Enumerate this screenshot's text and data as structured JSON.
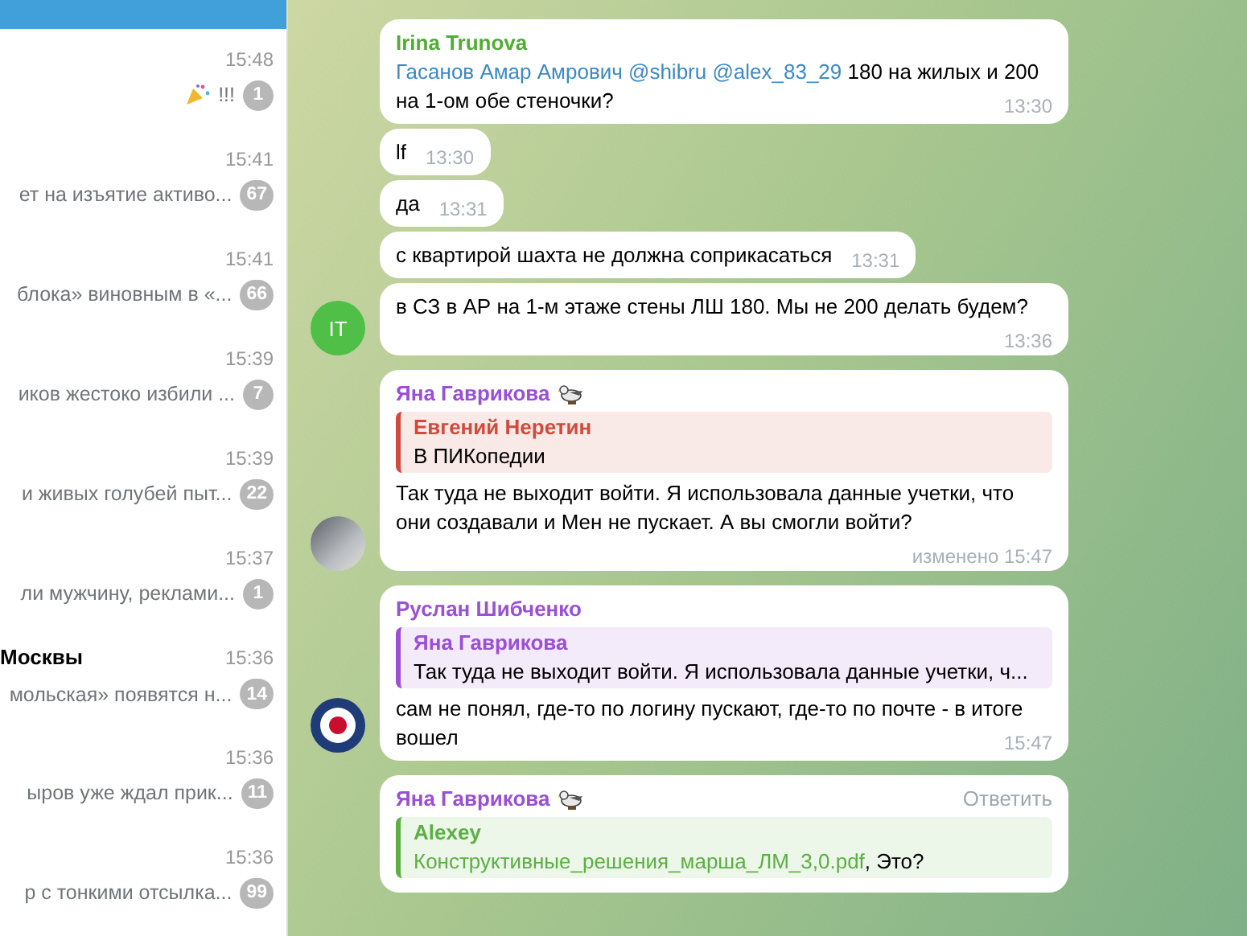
{
  "chat_list": [
    {
      "time": "15:48",
      "preview": "!!!",
      "preview_emoji": true,
      "badge": "1"
    },
    {
      "time": "15:41",
      "preview": "ет на изъятие активо...",
      "badge": "67"
    },
    {
      "time": "15:41",
      "preview": "блока» виновным в «...",
      "badge": "66"
    },
    {
      "time": "15:39",
      "preview": "иков жестоко избили ...",
      "badge": "7"
    },
    {
      "time": "15:39",
      "preview": "и живых голубей пыт...",
      "badge": "22"
    },
    {
      "time": "15:37",
      "preview": "ли мужчину, реклами...",
      "badge": "1"
    },
    {
      "title": "Москвы",
      "time": "15:36",
      "preview": "мольская» появятся н...",
      "badge": "14"
    },
    {
      "time": "15:36",
      "preview": "ыров  уже ждал прик...",
      "badge": "11"
    },
    {
      "time": "15:36",
      "preview": "р с тонкими отсылка...",
      "badge": "99"
    }
  ],
  "groups": [
    {
      "avatar": {
        "kind": "initials",
        "initials": "IT",
        "color": "#4fbf48"
      },
      "messages": [
        {
          "sender": "Irina Trunova",
          "color": "#4fae32",
          "parts": [
            {
              "kind": "mention",
              "text": "Гасанов Амар Амрович @shibru @alex_83_29"
            },
            {
              "kind": "text",
              "text": " 180 на жилых и 200 на 1-ом обе стеночки?"
            }
          ],
          "time": "13:30"
        },
        {
          "parts": [
            {
              "kind": "text",
              "text": "lf"
            }
          ],
          "time": "13:30"
        },
        {
          "parts": [
            {
              "kind": "text",
              "text": "да"
            }
          ],
          "time": "13:31"
        },
        {
          "parts": [
            {
              "kind": "text",
              "text": "с квартирой шахта не должна соприкасаться"
            }
          ],
          "time": "13:31"
        },
        {
          "parts": [
            {
              "kind": "text",
              "text": "в СЗ в АР на 1-м этаже стены ЛШ 180. Мы не 200 делать будем?"
            }
          ],
          "time": "13:36"
        }
      ]
    },
    {
      "avatar": {
        "kind": "photo"
      },
      "messages": [
        {
          "sender": "Яна Гаврикова",
          "color": "#9a4fd6",
          "sender_sticker": true,
          "reply": {
            "author": "Евгений Неретин",
            "color": "#d04a3d",
            "parts": [
              {
                "kind": "text",
                "text": "В ПИКопедии"
              }
            ]
          },
          "parts": [
            {
              "kind": "text",
              "text": "Так туда не выходит войти. Я использовала данные учетки, что они создавали и Мен не пускает. А вы смогли войти?"
            }
          ],
          "edited": "изменено",
          "time": "15:47"
        }
      ]
    },
    {
      "avatar": {
        "kind": "roundel"
      },
      "messages": [
        {
          "sender": "Руслан Шибченко",
          "color": "#9a4fd6",
          "reply": {
            "author": "Яна Гаврикова",
            "color": "#9a4fd6",
            "parts": [
              {
                "kind": "text",
                "text": "Так туда не выходит войти. Я использовала данные учетки, ч..."
              }
            ]
          },
          "parts": [
            {
              "kind": "text",
              "text": "сам не понял, где-то по логину пускают, где-то по почте - в итоге вошел"
            }
          ],
          "time": "15:47"
        }
      ]
    },
    {
      "messages": [
        {
          "sender": "Яна Гаврикова",
          "color": "#9a4fd6",
          "sender_sticker": true,
          "action": "Ответить",
          "reply": {
            "author": "Alexey",
            "color": "#5bb043",
            "parts": [
              {
                "kind": "file",
                "text": "Конструктивные_решения_марша_ЛМ_3,0.pdf"
              },
              {
                "kind": "text",
                "text": ", Это?"
              }
            ]
          }
        }
      ]
    }
  ]
}
